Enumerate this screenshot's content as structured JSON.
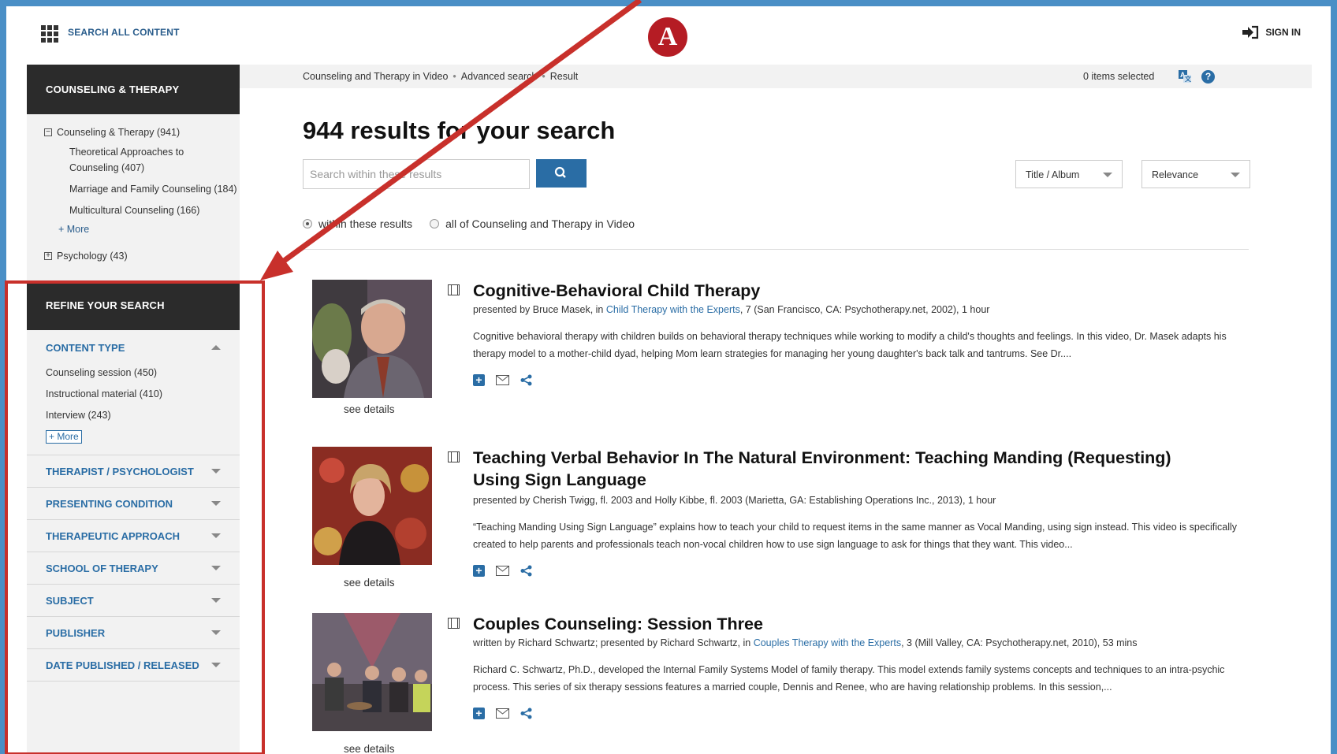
{
  "topbar": {
    "search_all_label": "SEARCH ALL CONTENT",
    "logo_letter": "A",
    "sign_in_label": "SIGN IN"
  },
  "sidebar": {
    "header": "COUNSELING & THERAPY",
    "tree": {
      "root_label": "Counseling & Therapy (941)",
      "children": [
        "Theoretical Approaches to",
        "Counseling (407)",
        "Marriage and Family Counseling (184)",
        "Multicultural Counseling (166)"
      ],
      "more_label": "+ More",
      "psychology_label": "Psychology (43)"
    },
    "refine_header": "REFINE YOUR SEARCH",
    "content_type": {
      "title": "CONTENT TYPE",
      "items": [
        "Counseling session (450)",
        "Instructional material (410)",
        "Interview (243)"
      ],
      "more_label": "+ More"
    },
    "facets": [
      "THERAPIST / PSYCHOLOGIST",
      "PRESENTING CONDITION",
      "THERAPEUTIC APPROACH",
      "SCHOOL OF THERAPY",
      "SUBJECT",
      "PUBLISHER",
      "DATE PUBLISHED / RELEASED"
    ]
  },
  "breadcrumb": {
    "items": [
      "Counseling and Therapy in Video",
      "Advanced search",
      "Result"
    ],
    "separator": "•",
    "items_selected": "0 items selected"
  },
  "main": {
    "results_title": "944 results for your search",
    "search_placeholder": "Search within these results",
    "select_field": "Title / Album",
    "select_sort": "Relevance",
    "radio_within": "within these results",
    "radio_all": "all of Counseling and Therapy in Video"
  },
  "results": [
    {
      "title": "Cognitive-Behavioral Child Therapy",
      "meta_prefix": "presented by Bruce Masek, in ",
      "meta_link": "Child Therapy with the Experts",
      "meta_suffix": ", 7 (San Francisco, CA: Psychotherapy.net, 2002), 1 hour",
      "description": "Cognitive behavioral therapy with children builds on behavioral therapy techniques while working to modify a child's thoughts and feelings. In this video, Dr. Masek adapts his therapy model to a mother-child dyad, helping Mom learn strategies for managing her young daughter's back talk and tantrums. See Dr....",
      "see_details": "see details"
    },
    {
      "title": "Teaching Verbal Behavior In The Natural Environment: Teaching Manding (Requesting) Using Sign Language",
      "meta_prefix": "presented by Cherish Twigg, fl. 2003 and Holly Kibbe, fl. 2003 (Marietta, GA: Establishing Operations Inc., 2013), 1 hour",
      "meta_link": "",
      "meta_suffix": "",
      "description": "“Teaching Manding Using Sign Language” explains how to teach your child to request items in the same manner as Vocal Manding, using sign instead. This video is specifically created to help parents and professionals teach non-vocal children how to use sign language to ask for things that they want. This video...",
      "see_details": "see details"
    },
    {
      "title": "Couples Counseling: Session Three",
      "meta_prefix": "written by Richard Schwartz; presented by Richard Schwartz, in ",
      "meta_link": "Couples Therapy with the Experts",
      "meta_suffix": ", 3 (Mill Valley, CA: Psychotherapy.net, 2010), 53 mins",
      "description": "Richard C. Schwartz, Ph.D., developed the Internal Family Systems Model of family therapy. This model extends family systems concepts and techniques to an intra-psychic process. This series of six therapy sessions features a married couple, Dennis and Renee, who are having relationship problems. In this session,...",
      "see_details": "see details"
    }
  ],
  "colors": {
    "accent": "#2a6da5",
    "annotation": "#c8302b",
    "sidebar_header": "#2b2b2b",
    "frame_border": "#4a8fc6"
  }
}
